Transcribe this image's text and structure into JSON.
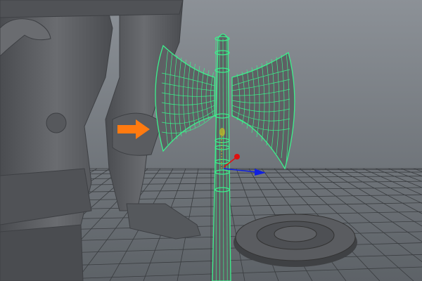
{
  "viewport": {
    "colors": {
      "background_top": "#8c9197",
      "background_bottom": "#5d6267",
      "grid": "#3a3d40",
      "model": "#5e6064",
      "model_shadow": "#45474a",
      "wireframe": "#3cf08c",
      "arrow": "#ff7a10",
      "gizmo_x": "#e01010",
      "gizmo_z": "#1020e0",
      "pivot": "#c8c020"
    },
    "icons": [
      "annotation-arrow-icon",
      "transform-gizmo-icon"
    ]
  }
}
